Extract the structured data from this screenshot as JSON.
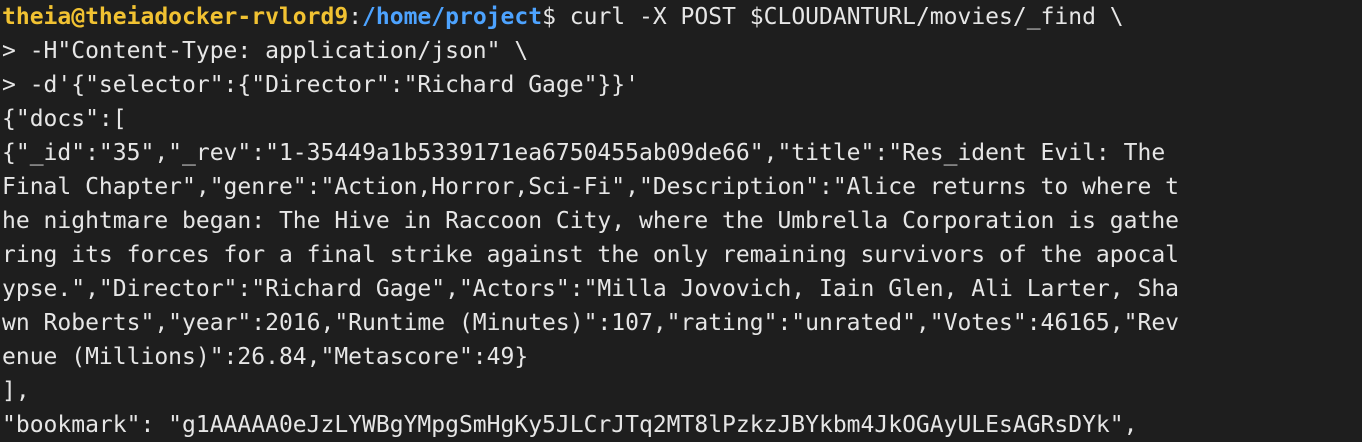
{
  "prompt": {
    "user_host": "theia@theiadocker-rvlord9",
    "colon": ":",
    "path": "/home/project",
    "dollar": "$"
  },
  "command_line": " curl -X POST $CLOUDANTURL/movies/_find \\",
  "output_lines": [
    "> -H\"Content-Type: application/json\" \\",
    "> -d'{\"selector\":{\"Director\":\"Richard Gage\"}}'",
    "{\"docs\":[",
    "{\"_id\":\"35\",\"_rev\":\"1-35449a1b5339171ea6750455ab09de66\",\"title\":\"Res_ident Evil: The",
    "Final Chapter\",\"genre\":\"Action,Horror,Sci-Fi\",\"Description\":\"Alice returns to where t",
    "he nightmare began: The Hive in Raccoon City, where the Umbrella Corporation is gathe",
    "ring its forces for a final strike against the only remaining survivors of the apocal",
    "ypse.\",\"Director\":\"Richard Gage\",\"Actors\":\"Milla Jovovich, Iain Glen, Ali Larter, Sha",
    "wn Roberts\",\"year\":2016,\"Runtime (Minutes)\":107,\"rating\":\"unrated\",\"Votes\":46165,\"Rev",
    "enue (Millions)\":26.84,\"Metascore\":49}",
    "],",
    "\"bookmark\": \"g1AAAAA0eJzLYWBgYMpgSmHgKy5JLCrJTq2MT8lPzkzJBYkbm4JkOGAyULEsAGRsDYk\","
  ],
  "colors": {
    "background": "#1e1e1e",
    "text": "#e6e6e6",
    "user_host": "#f1c232",
    "path": "#4da3ff"
  }
}
